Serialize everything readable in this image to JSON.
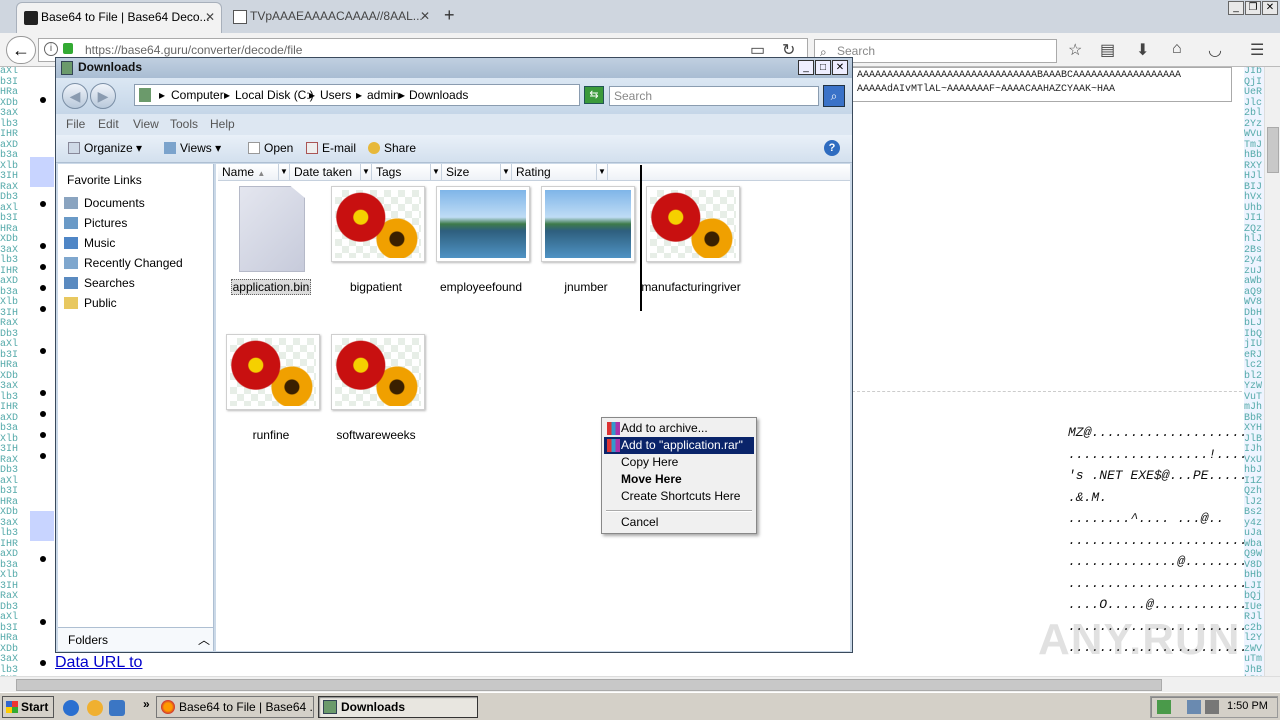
{
  "browser": {
    "tabs": [
      {
        "title": "Base64 to File | Base64 Deco...",
        "active": true
      },
      {
        "title": "TVpAAAEAAAACAAAA//8AAL...",
        "active": false
      }
    ],
    "url": "https://base64.guru/converter/decode/file",
    "search_placeholder": "Search"
  },
  "page": {
    "left_strip_text": "aXlb3IHRaXDb3aXlb3IHRaXDb3aXlb3IHRaXDb3aXlb3IHRaXDb3aXlb3IHRaXDb3aXlb3IHRaXDb3aXlb3IHRaXDb3aXlb3IHRaXDb3aXlb3IHRaXDb3aXlb3IHRaXDb3aXlb3IHRaXDb3aXlb3IHRaXDb3aXlb3IHRaXDb3aXlb3IHRaXDb3aXlb3IHRaXDb3aXlb3IHRaXDb3aXlb3IHRaXDb3aXlb3IHRaXDb3aXlb3IHRaXDb3aXlb3IHRaXDb3",
    "right_strip_text": "JIbQjIUeRJlc2bl2YzWVuTmJhBbRXYHJlBIJhVxUhbJI1ZQzhlJ2Bs2y4zuJaWbaQ9WV8DbHbLJIbQjIUeRJlc2bl2YzWVuTmJhBbRXYHJlBIJhVxUhbJI1ZQzhlJ2Bs2y4zuJaWbaQ9WV8DbHbLJIbQjIUeRJlc2bl2YzWVuTmJhBbRXYHJlBIJhVxUhbJI1ZQzhlJ2Bs2y4zuJaWbaQ9WV8DbHbL",
    "b64_line1": "AAAAAAAAAAAAAAAAAAAAAAAAAAAAAABAAABCAAAAAAAAAAAAAAAAAA",
    "b64_line2": "AAAAAdAIvMTlAL~AAAAAAAF~AAAACAAHAZCYAAK~HAA",
    "data_url_link": "Data URL to",
    "hex_dump": "MZ@.......................\n..................!....\n's .NET EXE$@...PE.....\n.&.M.\n........^.... ...@..\n.......................\n..............@.........\n.......................\n....O.....@.............\n.......................\n........................",
    "watermark": "ANY.RUN"
  },
  "explorer": {
    "title": "Downloads",
    "breadcrumb": [
      "Computer",
      "Local Disk (C:)",
      "Users",
      "admin",
      "Downloads"
    ],
    "search_placeholder": "Search",
    "menu": [
      "File",
      "Edit",
      "View",
      "Tools",
      "Help"
    ],
    "toolbar": {
      "organize": "Organize",
      "views": "Views",
      "open": "Open",
      "email": "E-mail",
      "share": "Share"
    },
    "favorite_links_title": "Favorite Links",
    "favorites": [
      "Documents",
      "Pictures",
      "Music",
      "Recently Changed",
      "Searches",
      "Public"
    ],
    "folders_label": "Folders",
    "columns": [
      "Name",
      "Date taken",
      "Tags",
      "Size",
      "Rating"
    ],
    "files": [
      {
        "name": "application.bin",
        "kind": "document",
        "selected": true
      },
      {
        "name": "bigpatient",
        "kind": "flower"
      },
      {
        "name": "employeefound",
        "kind": "landscape"
      },
      {
        "name": "jnumber",
        "kind": "landscape"
      },
      {
        "name": "manufacturingriver",
        "kind": "flower"
      },
      {
        "name": "runfine",
        "kind": "flower"
      },
      {
        "name": "softwareweeks",
        "kind": "flower"
      }
    ]
  },
  "context_menu": {
    "items": [
      "Add to archive...",
      "Add to \"application.rar\"",
      "Copy Here",
      "Move Here",
      "Create Shortcuts Here",
      "Cancel"
    ],
    "highlighted": "Add to \"application.rar\"",
    "default_item": "Move Here"
  },
  "taskbar": {
    "start": "Start",
    "more": "»",
    "tasks": [
      "Base64 to File | Base64 ...",
      "Downloads"
    ],
    "clock": "1:50 PM"
  },
  "colors": {
    "highlight": "#0a246a",
    "titlebar": "#a9bdd3",
    "taskbar": "#d4d0c8"
  }
}
